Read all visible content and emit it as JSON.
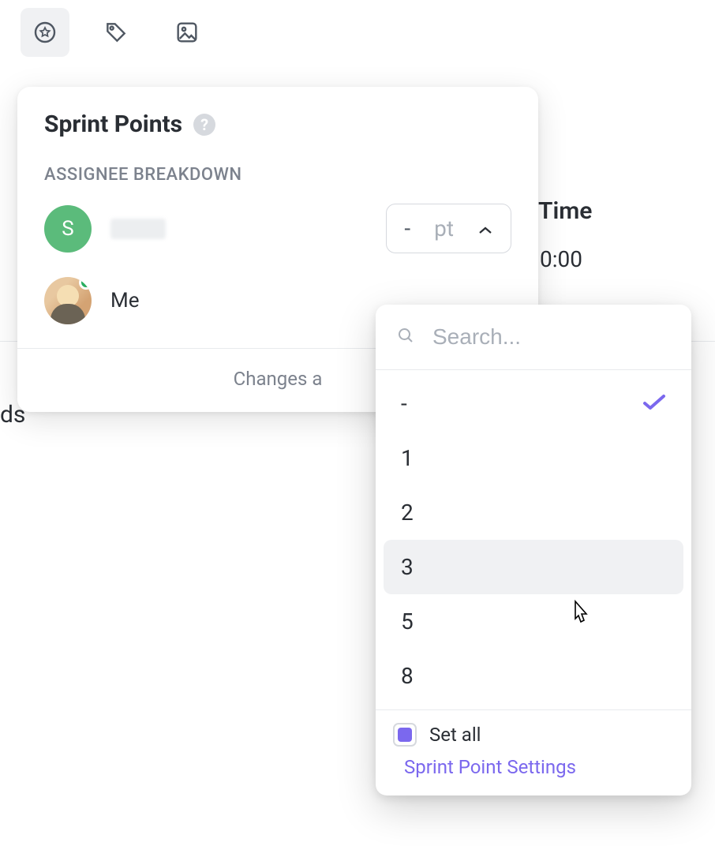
{
  "toolbar": {
    "icons": [
      "star-badge-icon",
      "tag-icon",
      "image-icon"
    ]
  },
  "background": {
    "fragment_left": "ds",
    "time_label": "Time",
    "time_value": "0:00"
  },
  "card": {
    "title": "Sprint Points",
    "help_glyph": "?",
    "section_label": "ASSIGNEE BREAKDOWN",
    "assignees": [
      {
        "initial": "S",
        "name_hidden": true,
        "name": "",
        "pt_value": "-",
        "pt_unit": "pt"
      },
      {
        "photo": true,
        "name": "Me",
        "online": true
      }
    ],
    "footer_text": "Changes a"
  },
  "dropdown": {
    "search_placeholder": "Search...",
    "options": [
      {
        "label": "-",
        "selected": true
      },
      {
        "label": "1"
      },
      {
        "label": "2"
      },
      {
        "label": "3",
        "hovered": true
      },
      {
        "label": "5"
      },
      {
        "label": "8"
      }
    ],
    "set_all_label": "Set all",
    "set_all_checked": true,
    "settings_link": "Sprint Point Settings"
  }
}
